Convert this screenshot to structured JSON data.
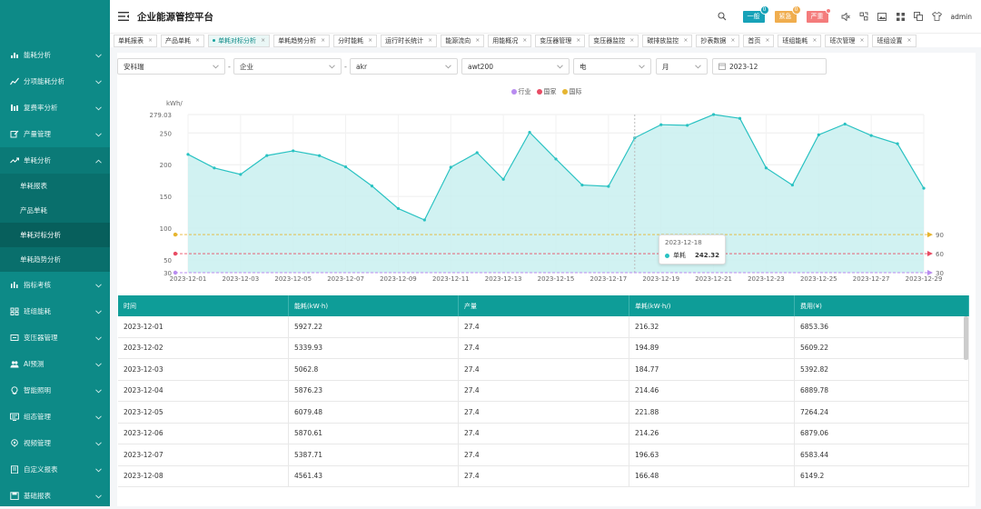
{
  "app": {
    "title": "企业能源管控平台"
  },
  "header": {
    "alarms": [
      {
        "label": "一般",
        "count": "0",
        "color": "#17a2b8"
      },
      {
        "label": "紧急",
        "count": "0",
        "color": "#f0ad4e"
      },
      {
        "label": "严重",
        "count": "",
        "color": "#f47c7c"
      }
    ],
    "user": "admin"
  },
  "sidebar": {
    "items": [
      {
        "label": "能耗分析",
        "icon": "bar-chart-icon"
      },
      {
        "label": "分项能耗分析",
        "icon": "line-chart-icon"
      },
      {
        "label": "复费率分析",
        "icon": "columns-icon"
      },
      {
        "label": "产量管理",
        "icon": "edit-icon"
      },
      {
        "label": "单耗分析",
        "icon": "trend-icon"
      }
    ],
    "sub": [
      {
        "label": "单耗报表"
      },
      {
        "label": "产品单耗"
      },
      {
        "label": "单耗对标分析"
      },
      {
        "label": "单耗趋势分析"
      }
    ],
    "items2": [
      {
        "label": "指标考核",
        "icon": "bars-icon"
      },
      {
        "label": "班组能耗",
        "icon": "grid-icon"
      },
      {
        "label": "变压器管理",
        "icon": "transformer-icon"
      },
      {
        "label": "AI预测",
        "icon": "users-icon"
      },
      {
        "label": "智能照明",
        "icon": "bulb-icon"
      },
      {
        "label": "组态管理",
        "icon": "monitor-icon"
      },
      {
        "label": "视频管理",
        "icon": "camera-icon"
      },
      {
        "label": "自定义报表",
        "icon": "report-icon"
      },
      {
        "label": "基础报表",
        "icon": "disk-icon"
      }
    ]
  },
  "tabs": [
    {
      "label": "单耗报表"
    },
    {
      "label": "产品单耗"
    },
    {
      "label": "单耗对标分析"
    },
    {
      "label": "单耗趋势分析"
    },
    {
      "label": "分时能耗"
    },
    {
      "label": "运行时长统计"
    },
    {
      "label": "能源流向"
    },
    {
      "label": "用能概况"
    },
    {
      "label": "变压器管理"
    },
    {
      "label": "变压器监控"
    },
    {
      "label": "碳排放监控"
    },
    {
      "label": "抄表数据"
    },
    {
      "label": "首页"
    },
    {
      "label": "班组能耗"
    },
    {
      "label": "班次管理"
    },
    {
      "label": "班组设置"
    }
  ],
  "filters": {
    "f1": "安科瑞",
    "f2": "企业",
    "f3": "akr",
    "f4": "awt200",
    "f5": "电",
    "f6": "月",
    "date": "2023-12"
  },
  "chart_data": {
    "type": "area",
    "ylabel": "kWh/",
    "ymax_label": "279.03",
    "ylim": [
      30,
      279.03
    ],
    "yticks": [
      250,
      200,
      150,
      100,
      50,
      30
    ],
    "legend_placement": "top-center",
    "x": [
      "2023-12-01",
      "2023-12-02",
      "2023-12-03",
      "2023-12-04",
      "2023-12-05",
      "2023-12-06",
      "2023-12-07",
      "2023-12-08",
      "2023-12-09",
      "2023-12-10",
      "2023-12-11",
      "2023-12-12",
      "2023-12-13",
      "2023-12-14",
      "2023-12-15",
      "2023-12-16",
      "2023-12-17",
      "2023-12-18",
      "2023-12-19",
      "2023-12-20",
      "2023-12-21",
      "2023-12-22",
      "2023-12-23",
      "2023-12-24",
      "2023-12-25",
      "2023-12-26",
      "2023-12-27",
      "2023-12-28",
      "2023-12-29"
    ],
    "xtick_labels": [
      "2023-12-01",
      "2023-12-03",
      "2023-12-05",
      "2023-12-07",
      "2023-12-09",
      "2023-12-11",
      "2023-12-13",
      "2023-12-15",
      "2023-12-17",
      "2023-12-19",
      "2023-12-21",
      "2023-12-23",
      "2023-12-25",
      "2023-12-27",
      "2023-12-29"
    ],
    "series": [
      {
        "name": "单耗",
        "color": "#29c2c2",
        "values": [
          216.32,
          194.89,
          184.77,
          214.46,
          221.88,
          214.26,
          196.63,
          166.48,
          131,
          113,
          196,
          219,
          177,
          251,
          209,
          168,
          166,
          242.32,
          263,
          262,
          279,
          273,
          195,
          168,
          247,
          264,
          246,
          233,
          163
        ]
      }
    ],
    "benchmarks": [
      {
        "name": "行业",
        "value": 30,
        "color": "#b98cf0"
      },
      {
        "name": "国家",
        "value": 60,
        "color": "#e84c64"
      },
      {
        "name": "国际",
        "value": 90,
        "color": "#e6b530"
      }
    ],
    "tooltip": {
      "date": "2023-12-18",
      "name": "单耗",
      "value": "242.32"
    }
  },
  "table": {
    "headers": [
      "时间",
      "能耗(kW·h)",
      "产量",
      "单耗(kW·h/)",
      "费用(¥)"
    ],
    "rows": [
      [
        "2023-12-01",
        "5927.22",
        "27.4",
        "216.32",
        "6853.36"
      ],
      [
        "2023-12-02",
        "5339.93",
        "27.4",
        "194.89",
        "5609.22"
      ],
      [
        "2023-12-03",
        "5062.8",
        "27.4",
        "184.77",
        "5392.82"
      ],
      [
        "2023-12-04",
        "5876.23",
        "27.4",
        "214.46",
        "6889.78"
      ],
      [
        "2023-12-05",
        "6079.48",
        "27.4",
        "221.88",
        "7264.24"
      ],
      [
        "2023-12-06",
        "5870.61",
        "27.4",
        "214.26",
        "6879.06"
      ],
      [
        "2023-12-07",
        "5387.71",
        "27.4",
        "196.63",
        "6583.44"
      ],
      [
        "2023-12-08",
        "4561.43",
        "27.4",
        "166.48",
        "6149.2"
      ]
    ]
  }
}
